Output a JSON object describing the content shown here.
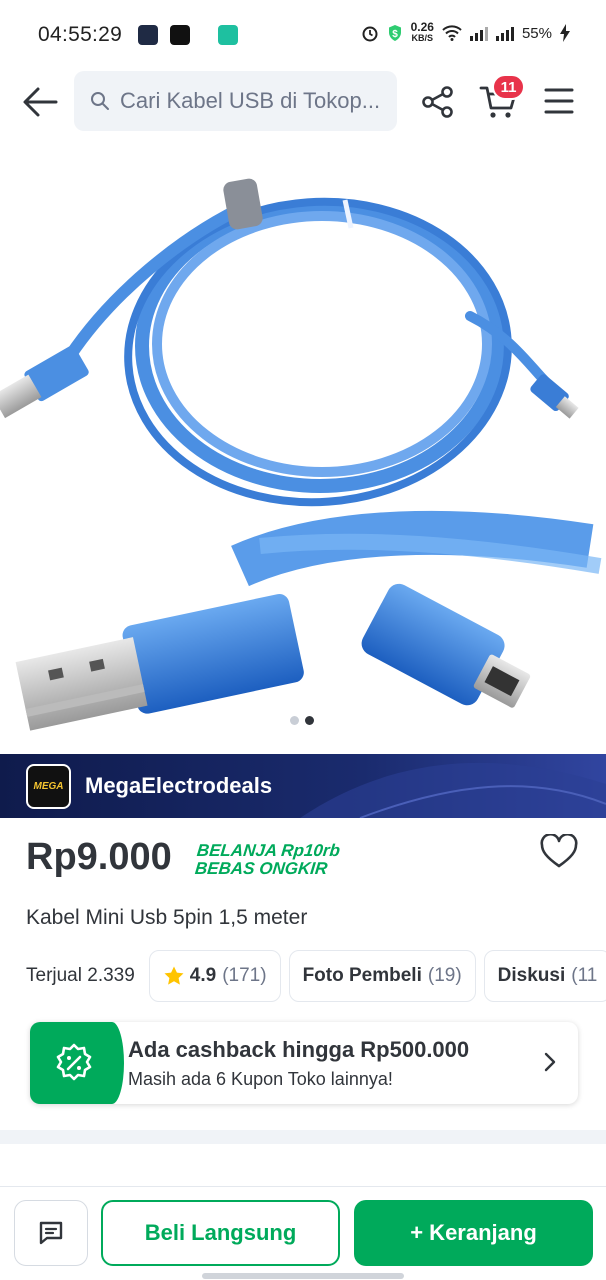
{
  "status_bar": {
    "time": "04:55:29",
    "net_speed_value": "0.26",
    "net_speed_unit": "KB/S",
    "battery": "55%"
  },
  "topnav": {
    "search_placeholder": "Cari Kabel USB di Tokop..."
  },
  "cart": {
    "badge_count": "11"
  },
  "carousel": {
    "total_slides": 2,
    "active_slide": 2
  },
  "shop": {
    "name": "MegaElectrodeals",
    "logo_text": "MEGA"
  },
  "product": {
    "price": "Rp9.000",
    "promo_line1": "BELANJA Rp10rb",
    "promo_line2": "BEBAS ONGKIR",
    "title": "Kabel Mini Usb 5pin 1,5 meter"
  },
  "stats": {
    "sold": "Terjual 2.339",
    "rating": "4.9",
    "rating_count": "(171)",
    "photos_label": "Foto Pembeli",
    "photos_count": "(19)",
    "discussion_label": "Diskusi",
    "discussion_count": "(11"
  },
  "cashback": {
    "title": "Ada cashback hingga Rp500.000",
    "subtitle": "Masih ada 6 Kupon Toko lainnya!"
  },
  "actions": {
    "buy_now": "Beli Langsung",
    "add_to_cart": "+ Keranjang"
  },
  "colors": {
    "brand_green": "#00aa5b",
    "badge_red": "#e8334a",
    "shop_banner": "#1a2b6e",
    "cable_blue": "#3f8fe0"
  }
}
